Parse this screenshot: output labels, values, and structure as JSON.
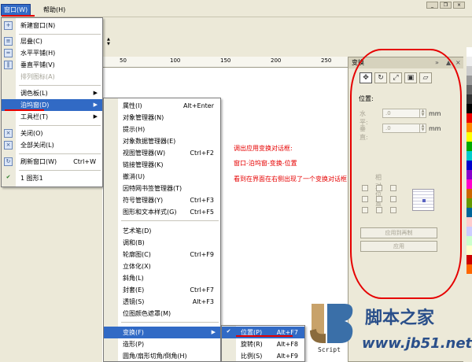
{
  "menubar": {
    "window_label": "窗口(W)",
    "help_label": "帮助(H)"
  },
  "window_menu": {
    "items": [
      {
        "label": "新建窗口(N)"
      },
      {
        "label": "层叠(C)"
      },
      {
        "label": "水平平铺(H)"
      },
      {
        "label": "垂直平铺(V)"
      },
      {
        "label": "排列图标(A)"
      },
      {
        "label": "调色板(L)"
      },
      {
        "label": "泊坞窗(D)"
      },
      {
        "label": "工具栏(T)"
      },
      {
        "label": "关闭(O)"
      },
      {
        "label": "全部关闭(L)"
      },
      {
        "label": "刷新窗口(W)",
        "shortcut": "Ctrl+W"
      },
      {
        "label": "1 图形1"
      }
    ]
  },
  "docker_menu": {
    "items": [
      {
        "label": "属性(I)",
        "shortcut": "Alt+Enter"
      },
      {
        "label": "对象管理器(N)"
      },
      {
        "label": "提示(H)"
      },
      {
        "label": "对象数据管理器(E)"
      },
      {
        "label": "视图管理器(W)",
        "shortcut": "Ctrl+F2"
      },
      {
        "label": "链接管理器(K)"
      },
      {
        "label": "撤消(U)"
      },
      {
        "label": "因特网书签管理器(T)"
      },
      {
        "label": "符号管理器(Y)",
        "shortcut": "Ctrl+F3"
      },
      {
        "label": "图形和文本样式(G)",
        "shortcut": "Ctrl+F5"
      },
      {
        "label": "艺术笔(D)"
      },
      {
        "label": "调和(B)"
      },
      {
        "label": "轮廓图(C)",
        "shortcut": "Ctrl+F9"
      },
      {
        "label": "立体化(X)"
      },
      {
        "label": "斜角(L)"
      },
      {
        "label": "封套(E)",
        "shortcut": "Ctrl+F7"
      },
      {
        "label": "透镜(S)",
        "shortcut": "Alt+F3"
      },
      {
        "label": "位图颜色遮罩(M)"
      },
      {
        "label": "变换(F)"
      },
      {
        "label": "造形(P)"
      },
      {
        "label": "圆角/扇形切角/倒角(H)"
      }
    ]
  },
  "transform_menu": {
    "items": [
      {
        "label": "位置(P)",
        "shortcut": "Alt+F7"
      },
      {
        "label": "旋转(R)",
        "shortcut": "Alt+F8"
      },
      {
        "label": "比例(S)",
        "shortcut": "Alt+F9"
      }
    ]
  },
  "docker": {
    "title": "变换",
    "section": "位置:",
    "h_label": "水平:",
    "v_label": "垂直:",
    "h_value": ".0",
    "v_value": ".0",
    "unit": "mm",
    "relative_label": "相对位置",
    "apply_dup_label": "应用到再制",
    "apply_label": "应用"
  },
  "ruler": {
    "labels": [
      "50",
      "100",
      "150",
      "200",
      "250"
    ]
  },
  "annotations": {
    "line1": "调出应用变换对话框:",
    "line2": "窗口-泊坞窗-变换-位置",
    "line3": "看到在界面在右侧出现了一个变换对话框"
  },
  "watermark": {
    "brand": "脚本之家",
    "url": "www.jb51.net",
    "script": "Script"
  },
  "colors": {
    "highlight": "#316ac5",
    "annotation": "#e60000"
  }
}
